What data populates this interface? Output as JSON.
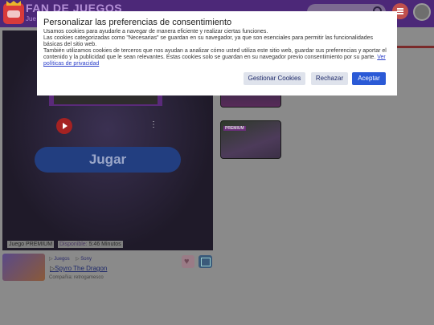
{
  "header": {
    "logo_text": "FAN DE JUEGOS",
    "logo_sub": "Jue",
    "search_placeholder": ""
  },
  "game": {
    "play_label": "Jugar",
    "premium_label": "Juego PREMIUM",
    "available_label": "Disponible:",
    "available_value": "5:46 Minutos",
    "breadcrumb_1": "Juegos",
    "breadcrumb_2": "Sony",
    "title": "Spyro The Dragon",
    "company": "Compañía: retrogamesco"
  },
  "sidebar": {
    "premium_tag": "PREMIUM"
  },
  "consent": {
    "title": "Personalizar las preferencias de consentimiento",
    "line1": "Usamos cookies para ayudarle a navegar de manera eficiente y realizar ciertas funciones.",
    "line2": "Las cookies categorizadas como \"Necesarias\" se guardan en su navegador, ya que son esenciales para permitir las funcionalidades básicas del sitio web.",
    "line3": "También utilizamos cookies de terceros que nos ayudan a analizar cómo usted utiliza este sitio web, guardar sus preferencias y aportar el contenido y la publicidad que le sean relevantes. Estas cookies solo se guardan en su navegador previo consentimiento por su parte.",
    "privacy_link": "Ver políticas de privacidad",
    "manage_label": "Gestionar Cookies",
    "reject_label": "Rechazar",
    "accept_label": "Aceptar"
  },
  "colors": {
    "header": "#4c2878",
    "accept": "#2b5ad6",
    "overlay": "#8a8a8a"
  }
}
